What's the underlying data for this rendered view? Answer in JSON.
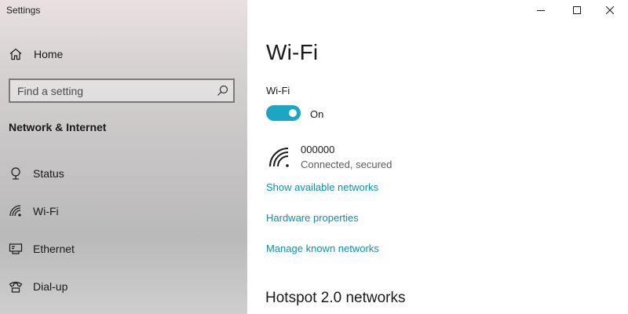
{
  "window": {
    "app_title": "Settings"
  },
  "sidebar": {
    "home_label": "Home",
    "search": {
      "placeholder": "Find a setting"
    },
    "section_heading": "Network & Internet",
    "items": [
      {
        "label": "Status",
        "icon": "status-icon"
      },
      {
        "label": "Wi-Fi",
        "icon": "wifi-icon"
      },
      {
        "label": "Ethernet",
        "icon": "ethernet-icon"
      },
      {
        "label": "Dial-up",
        "icon": "dialup-icon"
      }
    ]
  },
  "content": {
    "title": "Wi-Fi",
    "wifi_label": "Wi-Fi",
    "toggle": {
      "state_label": "On",
      "on": true
    },
    "network": {
      "name": "000000",
      "status": "Connected, secured"
    },
    "links": {
      "show_networks": "Show available networks",
      "hardware_properties": "Hardware properties",
      "manage_known": "Manage known networks"
    },
    "hotspot_heading": "Hotspot 2.0 networks"
  },
  "colors": {
    "accent": "#1ba7c3",
    "link": "#0f8fa8",
    "sidebar_top": "#e9e1e1",
    "sidebar_bottom": "#bab9b9"
  }
}
